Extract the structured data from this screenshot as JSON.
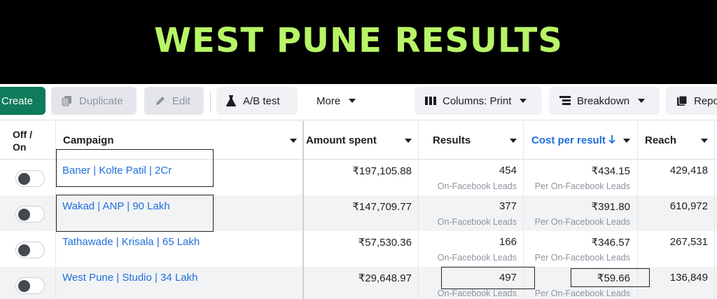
{
  "banner": {
    "title": "WEST PUNE RESULTS"
  },
  "toolbar": {
    "create": "Create",
    "duplicate": "Duplicate",
    "edit": "Edit",
    "ab_test": "A/B test",
    "more": "More",
    "columns": "Columns: Print",
    "breakdown": "Breakdown",
    "reports": "Repo"
  },
  "table": {
    "headers": {
      "offon_line1": "Off /",
      "offon_line2": "On",
      "campaign": "Campaign",
      "amount_spent": "Amount spent",
      "results": "Results",
      "cost_per_result": "Cost per result",
      "reach": "Reach"
    },
    "rows": [
      {
        "campaign": "Baner | Kolte Patil | 2Cr",
        "amount": "₹197,105.88",
        "results": "454",
        "results_sub": "On-Facebook Leads",
        "cost": "₹434.15",
        "cost_sub": "Per On-Facebook Leads",
        "reach": "429,418"
      },
      {
        "campaign": "Wakad | ANP | 90 Lakh",
        "amount": "₹147,709.77",
        "results": "377",
        "results_sub": "On-Facebook Leads",
        "cost": "₹391.80",
        "cost_sub": "Per On-Facebook Leads",
        "reach": "610,972"
      },
      {
        "campaign": "Tathawade | Krisala | 65 Lakh",
        "amount": "₹57,530.36",
        "results": "166",
        "results_sub": "On-Facebook Leads",
        "cost": "₹346.57",
        "cost_sub": "Per On-Facebook Leads",
        "reach": "267,531"
      },
      {
        "campaign": "West Pune | Studio | 34 Lakh",
        "amount": "₹29,648.97",
        "results": "497",
        "results_sub": "On-Facebook Leads",
        "cost": "₹59.66",
        "cost_sub": "Per On-Facebook Leads",
        "reach": "136,849"
      }
    ]
  },
  "colors": {
    "banner_text": "#b7f566",
    "create_button": "#0e7b5a",
    "link": "#216fdb"
  }
}
